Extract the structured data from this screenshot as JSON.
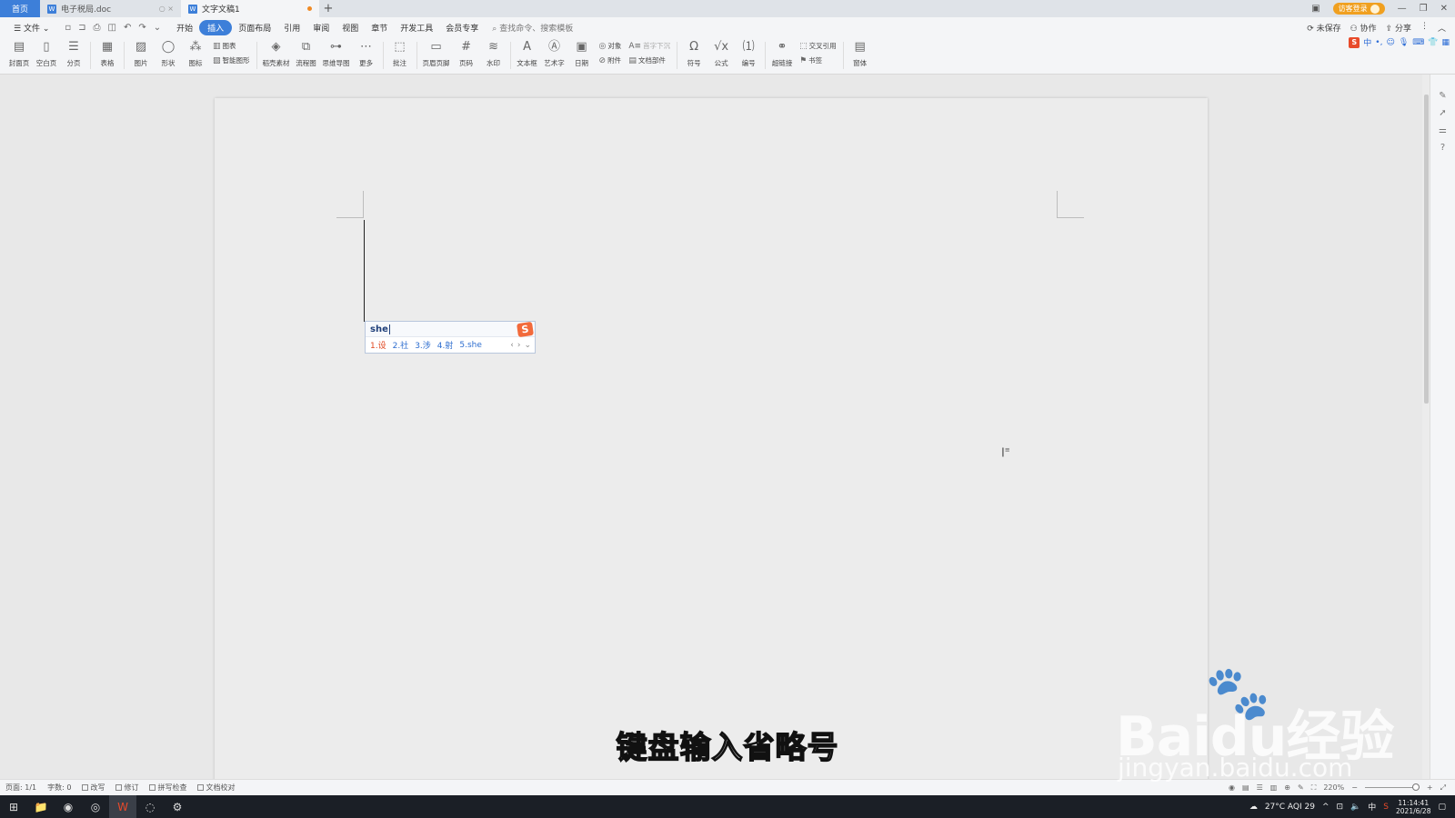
{
  "tabs": {
    "home": "首页",
    "doc1": "电子税局.doc",
    "doc2": "文字文稿1",
    "add": "+",
    "login": "访客登录"
  },
  "menu": {
    "file": "文件",
    "items": [
      "开始",
      "插入",
      "页面布局",
      "引用",
      "审阅",
      "视图",
      "章节",
      "开发工具",
      "会员专享"
    ],
    "active_index": 1,
    "search": "查找命令、搜索模板",
    "unsaved": "未保存",
    "collab": "协作",
    "share": "分享"
  },
  "ribbon": {
    "cover": "封面页",
    "blank": "空白页",
    "pagebreak": "分页",
    "table": "表格",
    "picture": "图片",
    "shape": "形状",
    "icons": "图标",
    "chart": "图表",
    "smartart": "智能图形",
    "material": "稻壳素材",
    "flowchart": "流程图",
    "mindmap": "思维导图",
    "more": "更多",
    "comment": "批注",
    "header_footer": "页眉页脚",
    "page_num": "页码",
    "watermark": "水印",
    "textbox": "文本框",
    "wordart": "艺术字",
    "date": "日期",
    "object": "对象",
    "dropcap": "首字下沉",
    "attach": "附件",
    "docpart": "文档部件",
    "symbol": "符号",
    "formula": "公式",
    "numbering": "编号",
    "hyperlink": "超链接",
    "crossref": "交叉引用",
    "bookmark": "书签",
    "window": "窗体"
  },
  "ime_toolbar": "中",
  "ime_popup": {
    "input": "she",
    "candidates": [
      "1.设",
      "2.社",
      "3.涉",
      "4.射",
      "5.she"
    ],
    "selected_index": 0
  },
  "status": {
    "page": "页面: 1/1",
    "words": "字数: 0",
    "rewrite": "改写",
    "revise": "修订",
    "spellcheck": "拼写检查",
    "proofread": "文档校对",
    "zoom": "220%"
  },
  "taskbar": {
    "weather": "27°C AQI 29",
    "lang": "中",
    "time": "11:14:41",
    "date": "2021/6/28"
  },
  "subtitle": "键盘输入省略号",
  "watermark": {
    "main": "Baidu经验",
    "sub": "jingyan.baidu.com"
  }
}
